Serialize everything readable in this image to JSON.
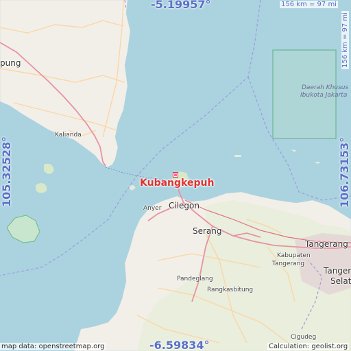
{
  "map": {
    "focus_place": "Kubangkepuh",
    "places": {
      "lampung": "pung",
      "kalianda": "Kalianda",
      "anyer": "Anyer",
      "cilegon": "Cilegon",
      "serang": "Serang",
      "tangerang": "Tangerang",
      "kabupaten_tangerang_1": "Kabupaten",
      "kabupaten_tangerang_2": "Tangerang",
      "tangerang_selatan_1": "Tanger",
      "tangerang_selatan_2": "Selat",
      "pandeglang": "Pandeglang",
      "rangkasbitung": "Rangkasbitung",
      "cigudeg": "Cigudeg",
      "jakarta_1": "Daerah Khusus",
      "jakarta_2": "Ibukota Jakarta"
    },
    "coords": {
      "lat_top": "-5.19957°",
      "lat_bottom": "-6.59834°",
      "lon_left": "105.32528°",
      "lon_right": "106.73153°"
    },
    "scale_top": "156 km = 97 mi",
    "scale_right": "156 km = 97 mi",
    "credit_left": "map data: openstreetmap.org",
    "credit_right": "Calculation: geolist.org",
    "colors": {
      "sea": "#aad3df",
      "land": "#f2efe9",
      "primary_road": "#e892a2",
      "secondary_road": "#fcd6a4",
      "boundary": "#9e9cdc",
      "reserve": "#8fc9a8",
      "marker": "#dd3333",
      "coord_text": "#5a70c8"
    }
  }
}
